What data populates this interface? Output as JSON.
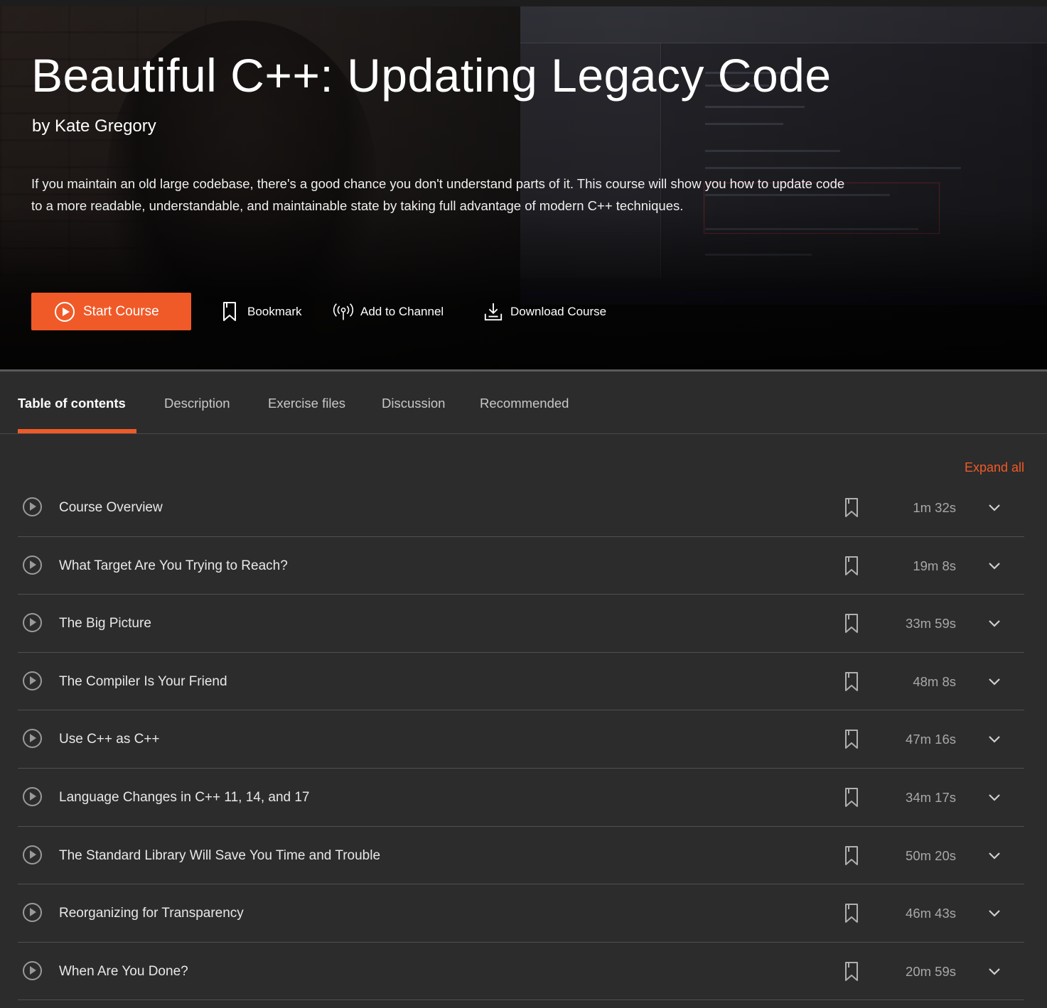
{
  "course": {
    "title": "Beautiful C++: Updating Legacy Code",
    "author": "by Kate Gregory",
    "summary": "If you maintain an old large codebase, there's a good chance you don't understand parts of it. This course will show you how to update code to a more readable, understandable, and maintainable state by taking full advantage of modern C++ techniques."
  },
  "actions": {
    "start": "Start Course",
    "bookmark": "Bookmark",
    "add_to_channel": "Add to Channel",
    "download": "Download Course"
  },
  "tabs": [
    {
      "label": "Table of contents",
      "active": true
    },
    {
      "label": "Description",
      "active": false
    },
    {
      "label": "Exercise files",
      "active": false
    },
    {
      "label": "Discussion",
      "active": false
    },
    {
      "label": "Recommended",
      "active": false
    }
  ],
  "toc": {
    "expand_all": "Expand all",
    "modules": [
      {
        "title": "Course Overview",
        "duration": "1m 32s"
      },
      {
        "title": "What Target Are You Trying to Reach?",
        "duration": "19m 8s"
      },
      {
        "title": "The Big Picture",
        "duration": "33m 59s"
      },
      {
        "title": "The Compiler Is Your Friend",
        "duration": "48m 8s"
      },
      {
        "title": "Use C++ as C++",
        "duration": "47m 16s"
      },
      {
        "title": "Language Changes in C++ 11, 14, and 17",
        "duration": "34m 17s"
      },
      {
        "title": "The Standard Library Will Save You Time and Trouble",
        "duration": "50m 20s"
      },
      {
        "title": "Reorganizing for Transparency",
        "duration": "46m 43s"
      },
      {
        "title": "When Are You Done?",
        "duration": "20m 59s"
      }
    ]
  },
  "colors": {
    "accent": "#f05a28",
    "background": "#2c2c2c"
  },
  "icons": {
    "start": "play-circle-icon",
    "bookmark": "bookmark-icon",
    "channel": "broadcast-icon",
    "download": "download-icon",
    "row_play": "play-circle-icon",
    "row_bookmark": "bookmark-icon",
    "row_expand": "chevron-down-icon"
  }
}
